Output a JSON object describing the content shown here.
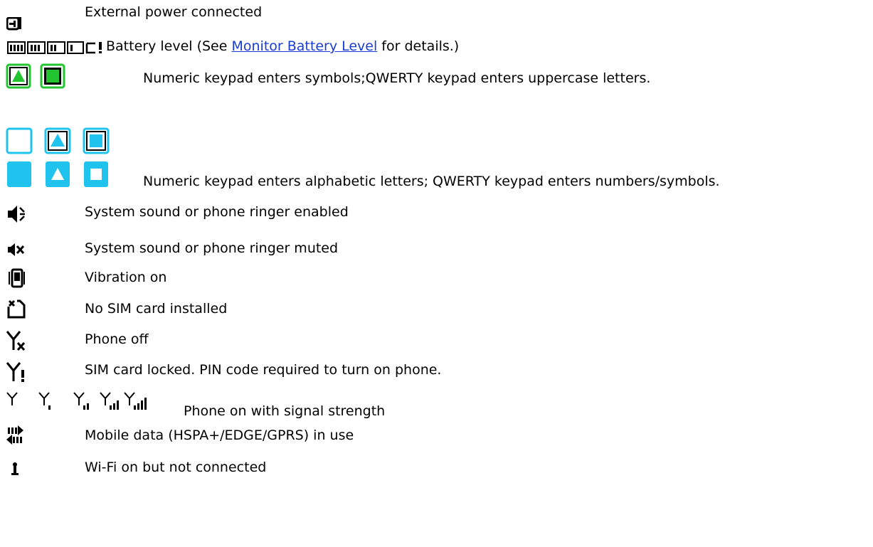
{
  "colors": {
    "accent_green": "#22c431",
    "accent_cyan": "#1fc3ee",
    "link": "#1a3cd6"
  },
  "items": [
    {
      "icon": "external-power-icon",
      "text": "External power connected"
    },
    {
      "icon": "battery-levels-icon",
      "text_before": "Battery level (See ",
      "link": "Monitor Battery Level",
      "text_after": " for details.)"
    },
    {
      "icon": "green-keypad-mode-icons",
      "text": "Numeric keypad enters symbols;QWERTY keypad enters uppercase letters."
    },
    {
      "icon": "cyan-keypad-mode-icons",
      "text": "Numeric keypad enters alphabetic letters; QWERTY keypad enters numbers/symbols."
    },
    {
      "icon": "speaker-on-icon",
      "text": "System sound or phone ringer enabled"
    },
    {
      "icon": "speaker-muted-icon",
      "text": "System sound or phone ringer muted"
    },
    {
      "icon": "vibration-icon",
      "text": "Vibration on"
    },
    {
      "icon": "no-sim-icon",
      "text": "No SIM card installed"
    },
    {
      "icon": "phone-off-icon",
      "text": "Phone off"
    },
    {
      "icon": "sim-locked-icon",
      "text": "SIM card locked. PIN code required to turn on phone."
    },
    {
      "icon": "signal-strength-icons",
      "text": "Phone on with signal strength"
    },
    {
      "icon": "mobile-data-icon",
      "text": "Mobile data (HSPA+/EDGE/GPRS) in use"
    },
    {
      "icon": "wifi-not-connected-icon",
      "text": "Wi-Fi on but not connected"
    }
  ]
}
